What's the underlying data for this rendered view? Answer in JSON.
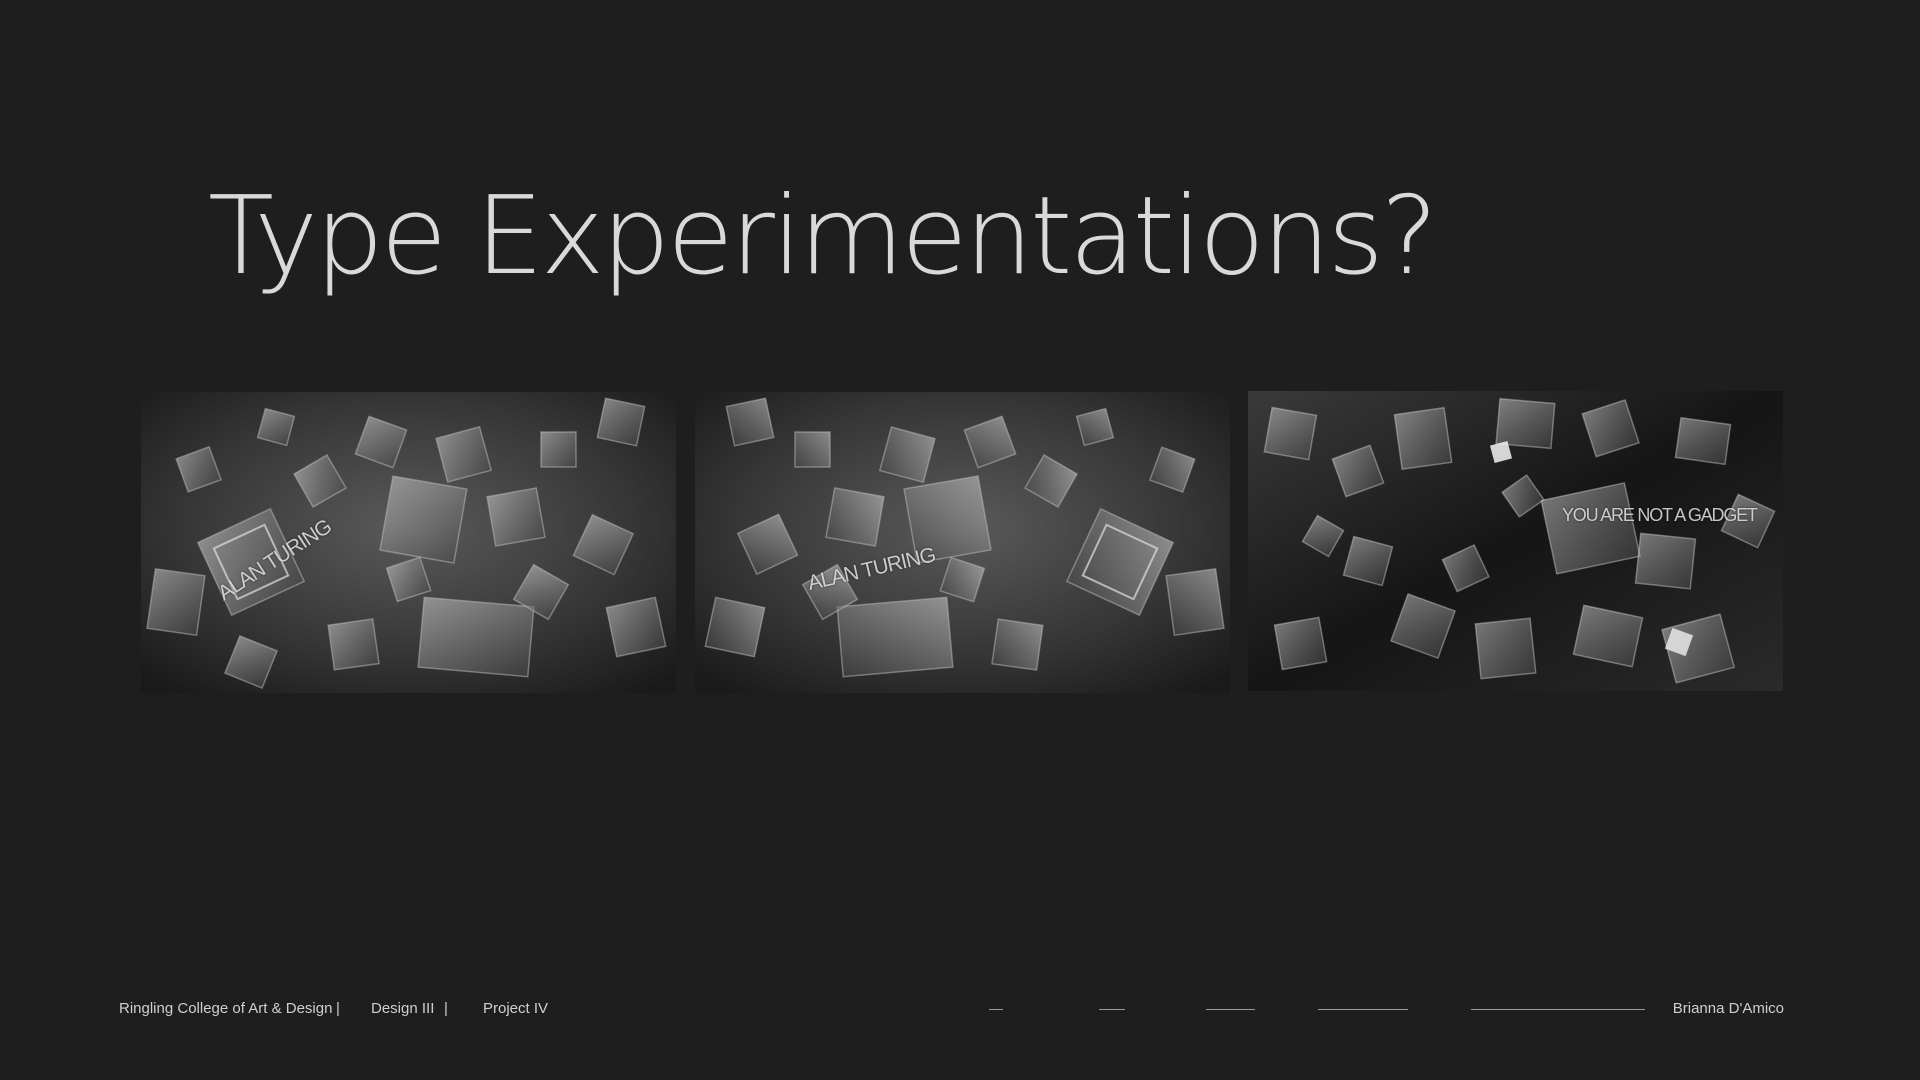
{
  "slide": {
    "title": "Type Experimentations?"
  },
  "gallery": [
    {
      "overlay_text": "ALAN TURING"
    },
    {
      "overlay_text": "ALAN TURING"
    },
    {
      "overlay_text": "YOU ARE NOT A GADGET"
    }
  ],
  "footer": {
    "school": "Ringling College of Art & Design",
    "separator": "|",
    "course": "Design III",
    "project": "Project IV",
    "author": "Brianna D'Amico"
  },
  "colors": {
    "background": "#1e1e1f",
    "title": "#d9d9d9",
    "footer_text": "#cfcfcf"
  }
}
